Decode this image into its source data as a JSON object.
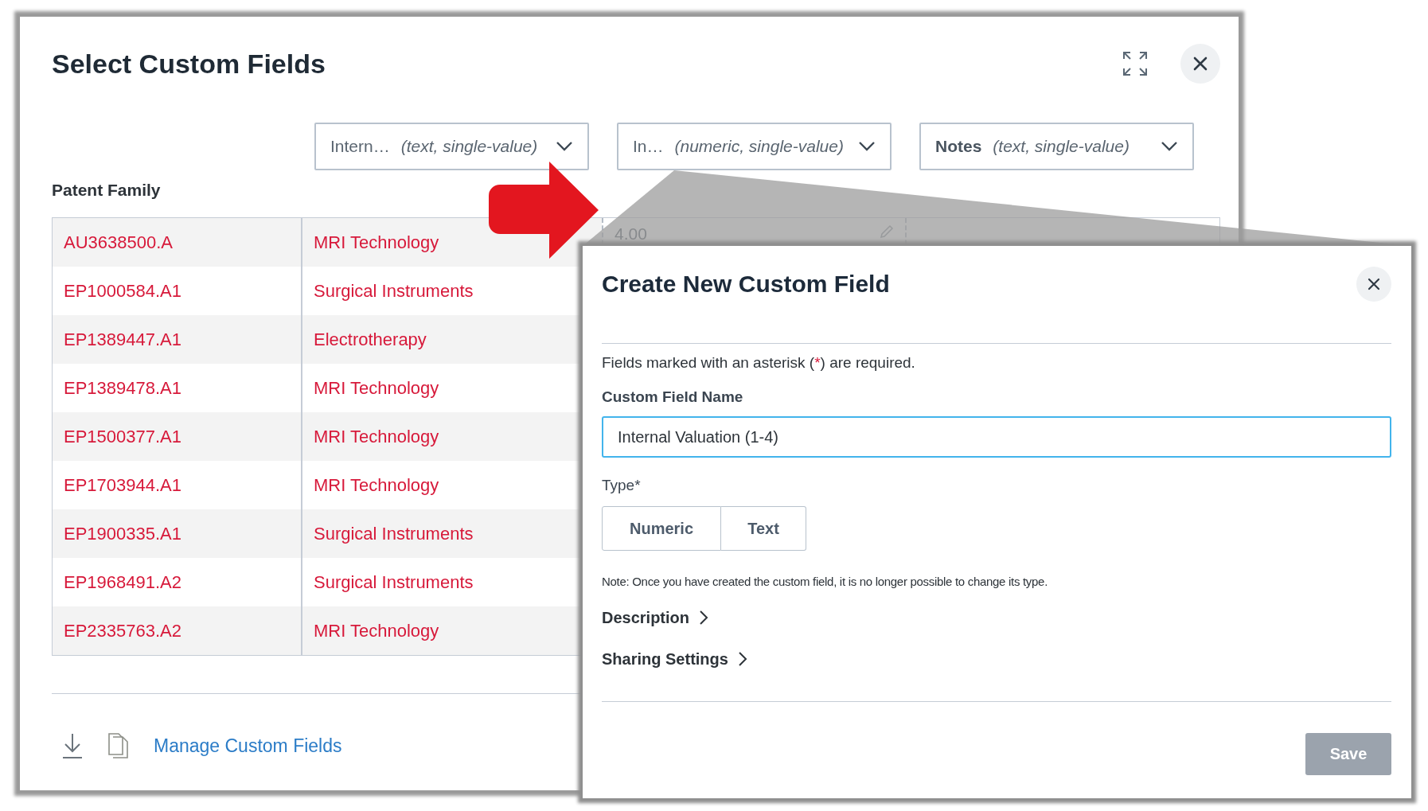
{
  "main_dialog": {
    "title": "Select Custom Fields"
  },
  "column_selectors": [
    {
      "name": "Intern…",
      "type": "(text, single-value)",
      "emphasized": false
    },
    {
      "name": "In…",
      "type": "(numeric, single-value)",
      "emphasized": false
    },
    {
      "name": "Notes",
      "type": "(text, single-value)",
      "emphasized": true
    }
  ],
  "table": {
    "title": "Patent Family",
    "rows": [
      {
        "publication": "AU3638500.A",
        "category": "MRI Technology",
        "value": "4.00"
      },
      {
        "publication": "EP1000584.A1",
        "category": "Surgical Instruments"
      },
      {
        "publication": "EP1389447.A1",
        "category": "Electrotherapy"
      },
      {
        "publication": "EP1389478.A1",
        "category": "MRI Technology"
      },
      {
        "publication": "EP1500377.A1",
        "category": "MRI Technology"
      },
      {
        "publication": "EP1703944.A1",
        "category": "MRI Technology"
      },
      {
        "publication": "EP1900335.A1",
        "category": "Surgical Instruments"
      },
      {
        "publication": "EP1968491.A2",
        "category": "Surgical Instruments"
      },
      {
        "publication": "EP2335763.A2",
        "category": "MRI Technology"
      }
    ]
  },
  "footer": {
    "link": "Manage Custom Fields"
  },
  "create_dialog": {
    "title": "Create New Custom Field",
    "required_note": [
      "Fields marked with an asterisk (",
      "*",
      ") are required."
    ],
    "name_label": "Custom Field Name",
    "name_value": "Internal Valuation (1-4)",
    "type_label": "Type*",
    "type_options": [
      {
        "label": "Numeric",
        "selected": false
      },
      {
        "label": "Text",
        "selected": false
      }
    ],
    "note": "Note: Once you have created the custom field, it is no longer possible to change its type.",
    "sections": [
      {
        "label": "Description",
        "expanded": false
      },
      {
        "label": "Sharing Settings",
        "expanded": false
      }
    ],
    "save": {
      "label": "Save",
      "disabled": true
    }
  }
}
